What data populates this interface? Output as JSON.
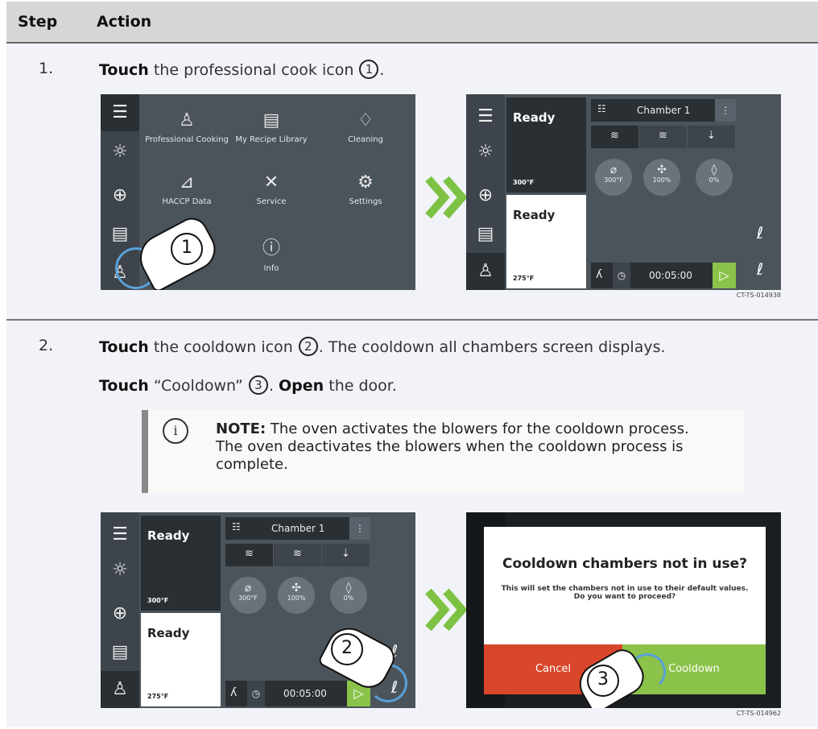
{
  "table": {
    "headers": {
      "step": "Step",
      "action": "Action"
    }
  },
  "step1": {
    "number": "1.",
    "verb": "Touch",
    "text": " the professional cook icon ",
    "callout": "1",
    "end": ".",
    "screen_a": {
      "menu": [
        {
          "icon": "professional-cook-icon",
          "glyph": "♙",
          "label": "Professional Cooking"
        },
        {
          "icon": "recipe-library-icon",
          "glyph": "▤",
          "label": "My Recipe Library"
        },
        {
          "icon": "cleaning-icon",
          "glyph": "♢",
          "label": "Cleaning"
        },
        {
          "icon": "haccp-icon",
          "glyph": "⊿",
          "label": "HACCP Data"
        },
        {
          "icon": "service-icon",
          "glyph": "✕",
          "label": "Service"
        },
        {
          "icon": "settings-icon",
          "glyph": "⚙",
          "label": "Settings"
        },
        {
          "icon": "info-icon",
          "glyph": "ⓘ",
          "label": "Info"
        }
      ],
      "callout": "1"
    },
    "screen_b": {
      "top_ready": "Ready",
      "top_temp": "300°F",
      "bottom_ready": "Ready",
      "bottom_temp": "275°F",
      "chamber": "Chamber 1",
      "knobs": [
        {
          "glyph": "⌀",
          "label": "300°F"
        },
        {
          "glyph": "✣",
          "label": "100%"
        },
        {
          "glyph": "◊",
          "label": "0%"
        }
      ],
      "timer": "00:05:00"
    },
    "code": "CT-TS-014938"
  },
  "step2": {
    "number": "2.",
    "line1": {
      "verb": "Touch",
      "text": " the cooldown icon ",
      "callout": "2",
      "rest": ". The cooldown all chambers screen displays."
    },
    "line2": {
      "verb": "Touch",
      "text": " “Cooldown” ",
      "callout": "3",
      "mid": ". ",
      "verb2": "Open",
      "rest": " the door."
    },
    "note": {
      "label": "NOTE:",
      "text": " The oven activates the blowers for the cooldown process. The oven deactivates the blowers when the cooldown process is complete."
    },
    "screen_c": {
      "top_ready": "Ready",
      "top_temp": "300°F",
      "bottom_ready": "Ready",
      "bottom_temp": "275°F",
      "chamber": "Chamber 1",
      "knobs": [
        {
          "glyph": "⌀",
          "label": "300°F"
        },
        {
          "glyph": "✣",
          "label": "100%"
        },
        {
          "glyph": "◊",
          "label": "0%"
        }
      ],
      "timer": "00:05:00",
      "callout": "2"
    },
    "screen_d": {
      "dialog_title": "Cooldown chambers not in use?",
      "dialog_message": "This will set the chambers not in use to their default values. Do you want to proceed?",
      "cancel": "Cancel",
      "confirm": "Cooldown",
      "callout": "3"
    },
    "code": "CT-TS-014962"
  },
  "colors": {
    "green": "#8bc34a",
    "red": "#d9472b",
    "dark": "#4b535b",
    "arrow": "#7dc242"
  }
}
